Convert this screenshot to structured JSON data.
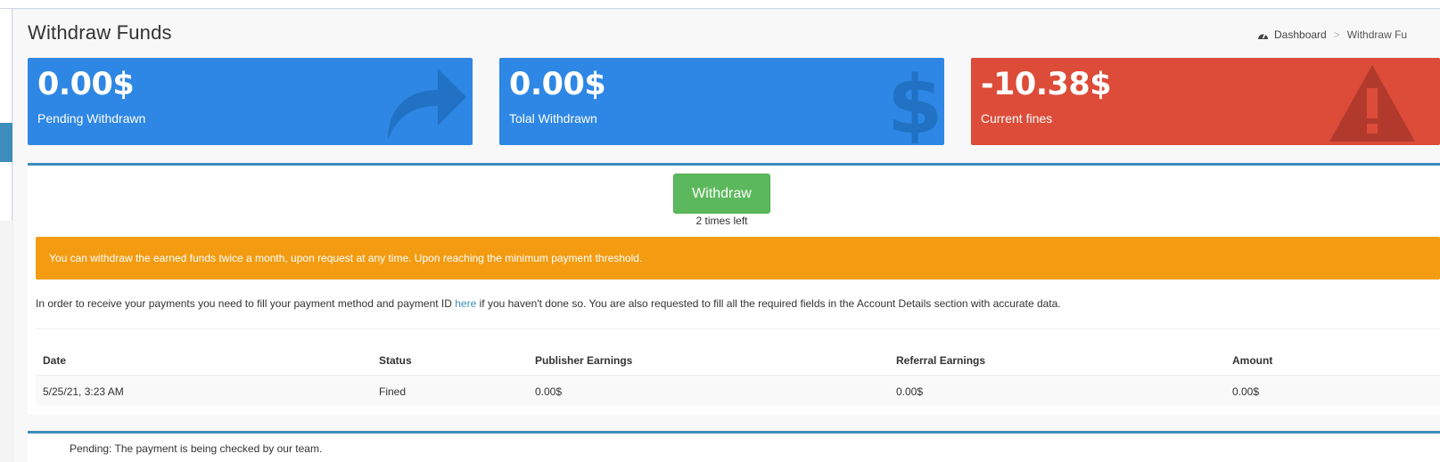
{
  "page": {
    "title": "Withdraw Funds",
    "breadcrumb": {
      "home": "Dashboard",
      "current": "Withdraw Fu"
    }
  },
  "stats": [
    {
      "value": "0.00$",
      "label": "Pending Withdrawn",
      "icon": "share-arrow-icon",
      "color": "#2e87e4"
    },
    {
      "value": "0.00$",
      "label": "Tolal Withdrawn",
      "icon": "dollar-icon",
      "color": "#2e87e4"
    },
    {
      "value": "-10.38$",
      "label": "Current fines",
      "icon": "warning-icon",
      "color": "#dd4b39"
    }
  ],
  "withdraw": {
    "button_label": "Withdraw",
    "times_left": "2 times left"
  },
  "alert": {
    "text": "You can withdraw the earned funds twice a month, upon request at any time. Upon reaching the minimum payment threshold.",
    "color": "#f39c12"
  },
  "info": {
    "before": "In order to receive your payments you need to fill your payment method and payment ID ",
    "link": "here",
    "after": " if you haven't done so. You are also requested to fill all the required fields in the Account Details section with accurate data."
  },
  "table": {
    "headers": [
      "Date",
      "Status",
      "Publisher Earnings",
      "Referral Earnings",
      "Amount"
    ],
    "rows": [
      [
        "5/25/21, 3:23 AM",
        "Fined",
        "0.00$",
        "0.00$",
        "0.00$"
      ]
    ]
  },
  "legend": {
    "pending": "Pending: The payment is being checked by our team."
  }
}
